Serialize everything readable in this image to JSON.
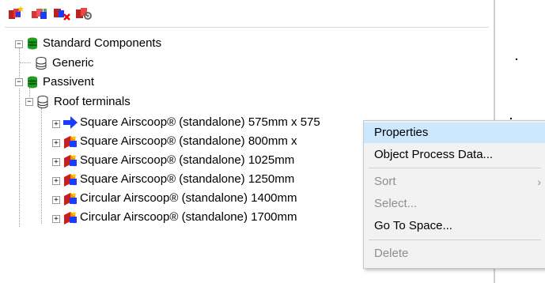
{
  "toolbar": {
    "buttons": [
      {
        "icon": "new-component-icon"
      },
      {
        "icon": "copy-component-icon"
      },
      {
        "icon": "delete-component-icon"
      },
      {
        "icon": "component-settings-icon"
      }
    ]
  },
  "tree": {
    "items": [
      {
        "label": "Standard Components",
        "icon": "database-green-icon",
        "expander": "−"
      },
      {
        "label": "Generic",
        "icon": "database-gray-icon"
      },
      {
        "label": "Passivent",
        "icon": "database-green-icon",
        "expander": "−"
      },
      {
        "label": "Roof terminals",
        "icon": "database-gray-icon",
        "expander": "−"
      },
      {
        "label": "Square Airscoop® (standalone) 575mm x 575",
        "icon": "blue-arrow-icon",
        "expander": "+"
      },
      {
        "label": "Square Airscoop® (standalone) 800mm x",
        "icon": "component-box-icon",
        "expander": "+"
      },
      {
        "label": "Square Airscoop® (standalone) 1025mm",
        "icon": "component-box-icon",
        "expander": "+"
      },
      {
        "label": "Square Airscoop® (standalone) 1250mm",
        "icon": "component-box-icon",
        "expander": "+"
      },
      {
        "label": "Circular Airscoop® (standalone) 1400mm",
        "icon": "component-box-icon",
        "expander": "+"
      },
      {
        "label": "Circular Airscoop® (standalone) 1700mm",
        "icon": "component-box-icon",
        "expander": "+"
      }
    ]
  },
  "context_menu": {
    "items": [
      {
        "label": "Properties",
        "state": "highlighted"
      },
      {
        "label": "Object Process Data...",
        "state": "enabled"
      },
      {
        "label": "Sort",
        "state": "disabled",
        "submenu": "›"
      },
      {
        "label": "Select...",
        "state": "disabled"
      },
      {
        "label": "Go To Space...",
        "state": "enabled"
      },
      {
        "label": "Delete",
        "state": "disabled"
      }
    ]
  },
  "colors": {
    "highlight": "#cce8ff",
    "menu_bg": "#f2f2f2",
    "disabled_text": "#8f8f8f",
    "db_green": "#1f9e1f",
    "arrow_blue": "#1a3cff"
  }
}
